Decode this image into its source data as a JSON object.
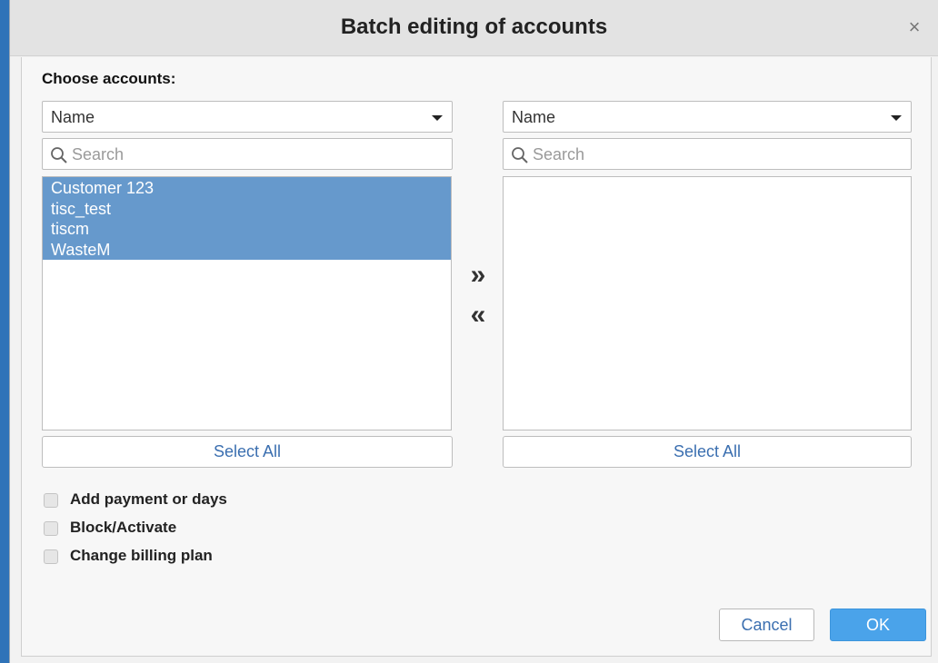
{
  "dialog": {
    "title": "Batch editing of accounts",
    "close_glyph": "×"
  },
  "choose_label": "Choose accounts:",
  "left_panel": {
    "filter_value": "Name",
    "search_placeholder": "Search",
    "items": [
      "Customer 123",
      "tisc_test",
      "tiscm",
      "WasteM"
    ],
    "select_all_label": "Select All"
  },
  "right_panel": {
    "filter_value": "Name",
    "search_placeholder": "Search",
    "items": [],
    "select_all_label": "Select All"
  },
  "transfer": {
    "move_right_glyph": "»",
    "move_left_glyph": "«"
  },
  "options": [
    {
      "label": "Add payment or days",
      "checked": false
    },
    {
      "label": "Block/Activate",
      "checked": false
    },
    {
      "label": "Change billing plan",
      "checked": false
    }
  ],
  "footer": {
    "cancel_label": "Cancel",
    "ok_label": "OK"
  },
  "colors": {
    "selected_item_bg": "#6699cc",
    "ok_button_bg": "#4aa3ea",
    "link_text": "#3b6fb0",
    "background_window": "#2f73b8"
  },
  "icons": {
    "search": "search-icon",
    "dropdown": "chevron-down-icon",
    "close": "close-icon",
    "move_right": "double-chevron-right-icon",
    "move_left": "double-chevron-left-icon"
  }
}
